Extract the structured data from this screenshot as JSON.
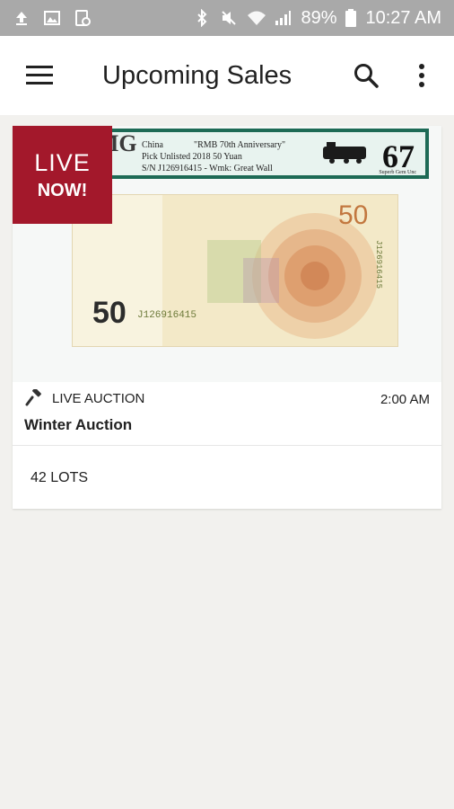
{
  "status_bar": {
    "battery": "89%",
    "time": "10:27 AM"
  },
  "app_bar": {
    "title": "Upcoming Sales"
  },
  "sales": [
    {
      "badge": {
        "line1": "LIVE",
        "line2": "NOW!"
      },
      "image": {
        "grader": "PMG",
        "line1_country": "China",
        "line1_title": "\"RMB 70th Anniversary\"",
        "line2": "Pick Unlisted   2018  50 Yuan",
        "line3": "S/N J126916415  - Wmk: Great Wall",
        "grade": "67",
        "grade_note": "Superb Gem Unc",
        "denomination": "50",
        "serial": "J126916415"
      },
      "type_label": "LIVE AUCTION",
      "type_icon": "gavel-icon",
      "time": "2:00 AM",
      "name": "Winter Auction",
      "lots": "42 LOTS"
    }
  ],
  "colors": {
    "status_bar_bg": "#a9a9a9",
    "badge_bg": "#a3182b",
    "page_bg": "#f2f1ee",
    "slab_green": "#1d6a55"
  }
}
